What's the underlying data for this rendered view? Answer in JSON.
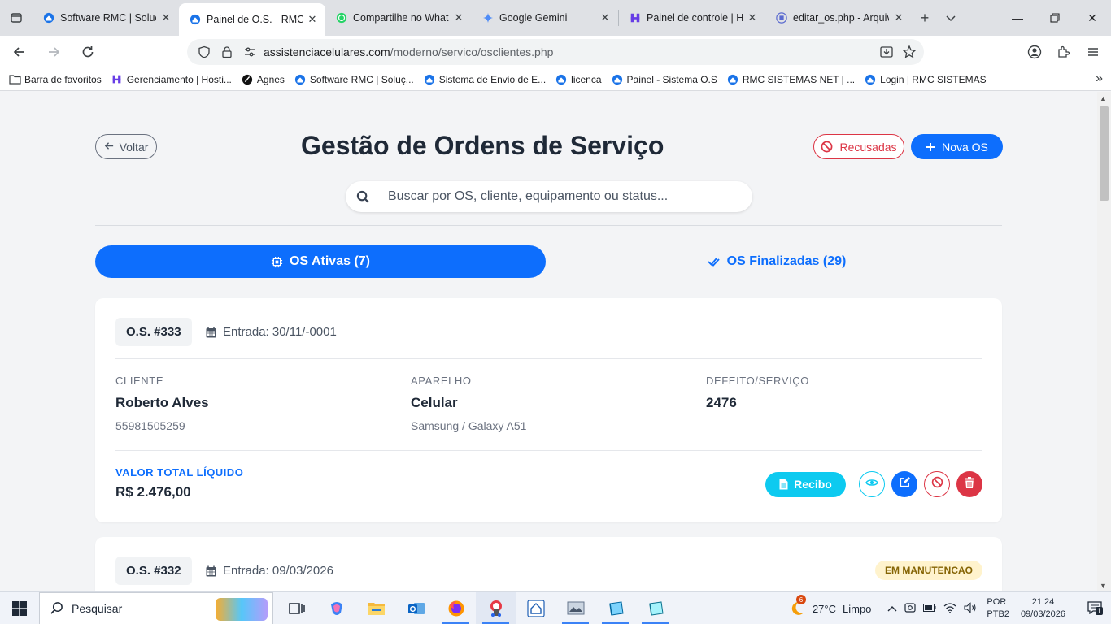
{
  "browser": {
    "tabs": [
      {
        "title": "Software RMC | Soluçõ",
        "icon": "home-icon",
        "active": false
      },
      {
        "title": "Painel de O.S. - RMC S",
        "icon": "home-icon",
        "active": true
      },
      {
        "title": "Compartilhe no Whats",
        "icon": "whatsapp-icon",
        "active": false
      },
      {
        "title": "Google Gemini",
        "icon": "gemini-icon",
        "active": false
      },
      {
        "title": "Painel de controle | Ho",
        "icon": "hostinger-icon",
        "active": false
      },
      {
        "title": "editar_os.php - Arquiv",
        "icon": "file-icon",
        "active": false
      }
    ],
    "url_host": "assistenciacelulares.com",
    "url_path": "/moderno/servico/osclientes.php",
    "bookmarks": [
      {
        "label": "Barra de favoritos",
        "icon": "folder-icon"
      },
      {
        "label": "Gerenciamento | Hosti...",
        "icon": "hostinger-icon"
      },
      {
        "label": "Agnes",
        "icon": "agnes-icon"
      },
      {
        "label": "Software RMC | Soluç...",
        "icon": "home-icon"
      },
      {
        "label": "Sistema de Envio de E...",
        "icon": "home-icon"
      },
      {
        "label": "licenca",
        "icon": "home-icon"
      },
      {
        "label": "Painel - Sistema O.S",
        "icon": "home-icon"
      },
      {
        "label": "RMC SISTEMAS NET | ...",
        "icon": "home-icon"
      },
      {
        "label": "Login | RMC SISTEMAS",
        "icon": "home-icon"
      }
    ]
  },
  "page": {
    "back_label": "Voltar",
    "title": "Gestão de Ordens de Serviço",
    "refused_label": "Recusadas",
    "new_label": "Nova OS",
    "search_placeholder": "Buscar por OS, cliente, equipamento ou status...",
    "tab_active_label": "OS Ativas (7)",
    "tab_finished_label": "OS Finalizadas (29)"
  },
  "orders": [
    {
      "number": "O.S. #333",
      "entrada": "Entrada: 30/11/-0001",
      "cliente_label": "CLIENTE",
      "cliente_nome": "Roberto Alves",
      "cliente_tel": "55981505259",
      "aparelho_label": "APARELHO",
      "aparelho_tipo": "Celular",
      "aparelho_modelo": "Samsung / Galaxy A51",
      "defeito_label": "DEFEITO/SERVIÇO",
      "defeito": "2476",
      "valor_label": "VALOR TOTAL LÍQUIDO",
      "valor": "R$ 2.476,00",
      "recibo_label": "Recibo"
    },
    {
      "number": "O.S. #332",
      "entrada": "Entrada: 09/03/2026",
      "status": "EM MANUTENCAO"
    }
  ],
  "taskbar": {
    "search_label": "Pesquisar",
    "weather_temp": "27°C",
    "weather_desc": "Limpo",
    "weather_badge": "6",
    "lang_1": "POR",
    "lang_2": "PTB2",
    "time": "21:24",
    "date": "09/03/2026",
    "notif_count": "1"
  },
  "colors": {
    "primary": "#0d6efd",
    "danger": "#dc3545",
    "info": "#0dcaf0",
    "warning_bg": "#fff3cd"
  }
}
